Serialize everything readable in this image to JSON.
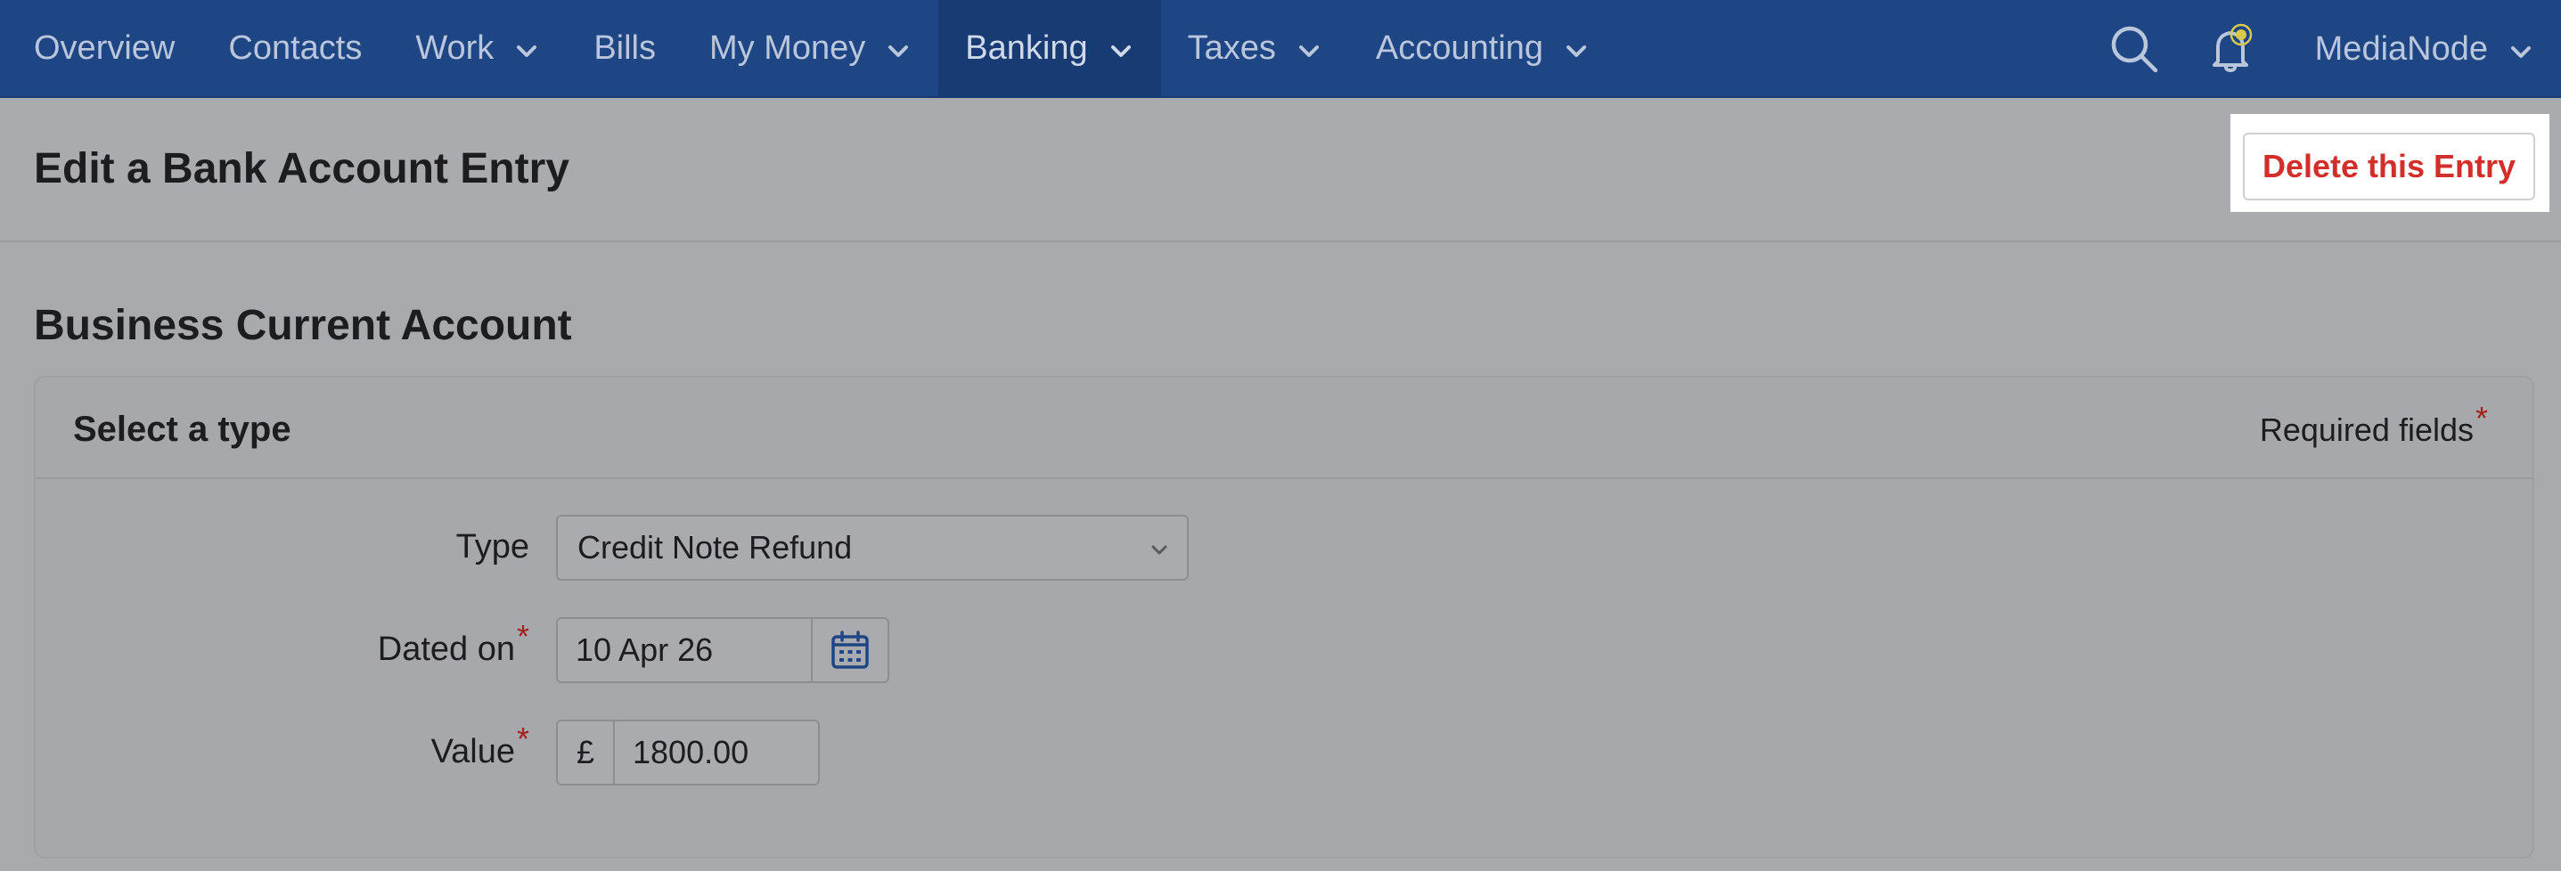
{
  "nav": {
    "items": [
      {
        "label": "Overview",
        "dropdown": false,
        "active": false
      },
      {
        "label": "Contacts",
        "dropdown": false,
        "active": false
      },
      {
        "label": "Work",
        "dropdown": true,
        "active": false
      },
      {
        "label": "Bills",
        "dropdown": false,
        "active": false
      },
      {
        "label": "My Money",
        "dropdown": true,
        "active": false
      },
      {
        "label": "Banking",
        "dropdown": true,
        "active": true
      },
      {
        "label": "Taxes",
        "dropdown": true,
        "active": false
      },
      {
        "label": "Accounting",
        "dropdown": true,
        "active": false
      }
    ],
    "user": "MediaNode"
  },
  "header": {
    "title": "Edit a Bank Account Entry",
    "delete_label": "Delete this Entry"
  },
  "account_title": "Business Current Account",
  "form": {
    "section_title": "Select a type",
    "required_label": "Required fields",
    "required_mark": "*",
    "type_label": "Type",
    "type_value": "Credit Note Refund",
    "date_label": "Dated on",
    "date_value": "10 Apr 26",
    "value_label": "Value",
    "currency_symbol": "£",
    "value_amount": "1800.00"
  },
  "colors": {
    "nav_bg": "#1f4684",
    "nav_active": "#183b73",
    "delete_text": "#d22e2a",
    "required_star": "#a3211c",
    "notification_dot": "#d8c94a"
  }
}
